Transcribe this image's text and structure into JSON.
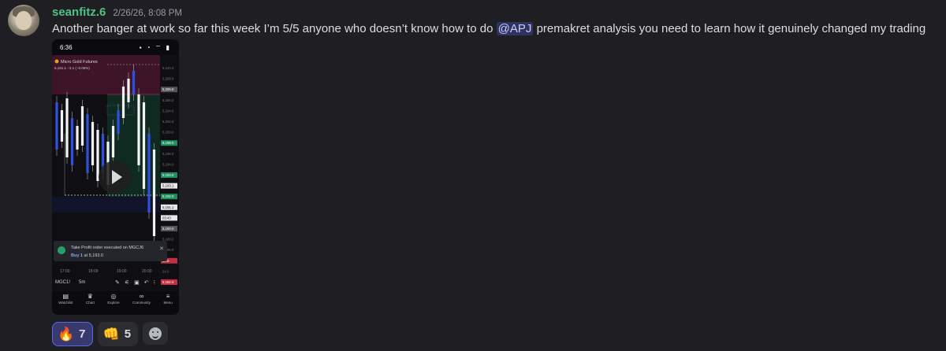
{
  "message": {
    "username": "seanfitz.6",
    "timestamp": "2/26/26, 8:08 PM",
    "text_before": "Another banger at work so far this week I’m 5/5 anyone who doesn’t know how to do ",
    "mention": "@APJ",
    "text_after": " premakret analysis you need to learn how it genuinely changed my trading"
  },
  "attachment": {
    "status_time": "6:36",
    "status_icons": "▪ ◔ ⌔ ▮",
    "ticker_title": "Micro Gold Futures",
    "price_line": "5,191.1 −3.1 (−0.06%)",
    "price_labels": [
      {
        "text": "5,210.0",
        "tone": "plain"
      },
      {
        "text": "5,208.0",
        "tone": "plain"
      },
      {
        "text": "5,206.0",
        "tone": "grey"
      },
      {
        "text": "5,206.0",
        "tone": "plain"
      },
      {
        "text": "5,204.0",
        "tone": "plain"
      },
      {
        "text": "5,202.0",
        "tone": "plain"
      },
      {
        "text": "5,200.0",
        "tone": "plain"
      },
      {
        "text": "5,198.0",
        "tone": "green"
      },
      {
        "text": "5,196.0",
        "tone": "plain"
      },
      {
        "text": "5,194.0",
        "tone": "plain"
      },
      {
        "text": "5,193.0",
        "tone": "green"
      },
      {
        "text": "5,193.1",
        "tone": "white"
      },
      {
        "text": "5,192.0",
        "tone": "green"
      },
      {
        "text": "5,191.1",
        "tone": "white"
      },
      {
        "text": "03:43",
        "tone": "white"
      },
      {
        "text": "5,190.0",
        "tone": "grey"
      },
      {
        "text": "5,188.0",
        "tone": "plain"
      },
      {
        "text": "5,186.0",
        "tone": "plain"
      },
      {
        "text": "18.0",
        "tone": "red"
      },
      {
        "text": "24.0",
        "tone": "plain"
      },
      {
        "text": "5,182.0",
        "tone": "red"
      }
    ],
    "toast_title": "Take Profit order executed on",
    "toast_symbol": "MGCJ6",
    "toast_side": "Buy 1",
    "toast_price": "at 5,193.0",
    "time_labels": [
      "17:00",
      "18:00",
      "19:00",
      "20:00"
    ],
    "symbol": "MGC1!",
    "timeframe": "5m",
    "nav": [
      {
        "icon": "watchlist-icon",
        "glyph": "▤",
        "label": "Watchlist"
      },
      {
        "icon": "chart-icon",
        "glyph": "♛",
        "label": "Chart"
      },
      {
        "icon": "explore-icon",
        "glyph": "◎",
        "label": "Explore"
      },
      {
        "icon": "community-icon",
        "glyph": "∞",
        "label": "Community"
      },
      {
        "icon": "menu-icon",
        "glyph": "≡",
        "label": "Menu"
      }
    ]
  },
  "reactions": [
    {
      "emoji": "🔥",
      "icon": "fire-emoji-icon",
      "count": "7",
      "active": true
    },
    {
      "emoji": "👊",
      "icon": "fist-emoji-icon",
      "count": "5",
      "active": false
    }
  ]
}
